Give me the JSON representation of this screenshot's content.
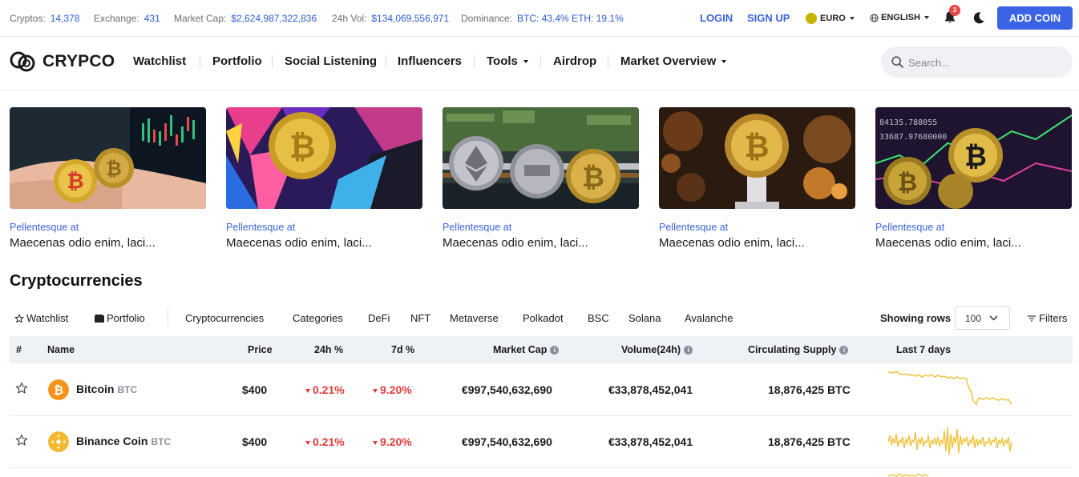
{
  "topbar": {
    "stats": [
      {
        "label": "Cryptos:",
        "value": "14,378"
      },
      {
        "label": "Exchange:",
        "value": "431"
      },
      {
        "label": "Market Cap:",
        "value": "$2,624,987,322,836"
      },
      {
        "label": "24h Vol:",
        "value": "$134,069,556,971"
      },
      {
        "label": "Dominance:",
        "value": "BTC: 43.4% ETH: 19.1%"
      }
    ],
    "login": "LOGIN",
    "signup": "SIGN UP",
    "currency": "EURO",
    "language": "ENGLISH",
    "notifications": "3",
    "add_coin": "ADD COIN"
  },
  "nav": {
    "logo": "CRYPCO",
    "items": [
      "Watchlist",
      "Portfolio",
      "Social Listening",
      "Influencers",
      "Tools",
      "Airdrop",
      "Market Overview"
    ],
    "search_placeholder": "Search..."
  },
  "news": [
    {
      "category": "Pellentesque at",
      "title": "Maecenas odio enim, laci..."
    },
    {
      "category": "Pellentesque at",
      "title": "Maecenas odio enim, laci..."
    },
    {
      "category": "Pellentesque at",
      "title": "Maecenas odio enim, laci..."
    },
    {
      "category": "Pellentesque at",
      "title": "Maecenas odio enim, laci..."
    },
    {
      "category": "Pellentesque at",
      "title": "Maecenas odio enim, laci..."
    }
  ],
  "section": {
    "title": "Cryptocurrencies",
    "filters": [
      "Watchlist",
      "Portfolio",
      "Cryptocurrencies",
      "Categories",
      "DeFi",
      "NFT",
      "Metaverse",
      "Polkadot",
      "BSC",
      "Solana",
      "Avalanche"
    ],
    "showing_rows_label": "Showing rows",
    "rows_value": "100",
    "filters_label": "Filters"
  },
  "table": {
    "headers": [
      "#",
      "Name",
      "Price",
      "24h %",
      "7d %",
      "Market Cap",
      "Volume(24h)",
      "Circulating Supply",
      "Last 7 days"
    ],
    "rows": [
      {
        "name": "Bitcoin",
        "symbol": "BTC",
        "price": "$400",
        "h24": "0.21%",
        "d7": "9.20%",
        "market_cap": "€997,540,632,690",
        "volume": "€33,878,452,041",
        "supply": "18,876,425 BTC"
      },
      {
        "name": "Binance Coin",
        "symbol": "BTC",
        "price": "$400",
        "h24": "0.21%",
        "d7": "9.20%",
        "market_cap": "€997,540,632,690",
        "volume": "€33,878,452,041",
        "supply": "18,876,425 BTC"
      }
    ]
  },
  "colors": {
    "accent": "#3b63e6",
    "link": "#2f5bd8",
    "negative": "#e23b3b",
    "bitcoin": "#f7931a",
    "binance": "#f3ba2f",
    "sparkline": "#f0c23b"
  }
}
